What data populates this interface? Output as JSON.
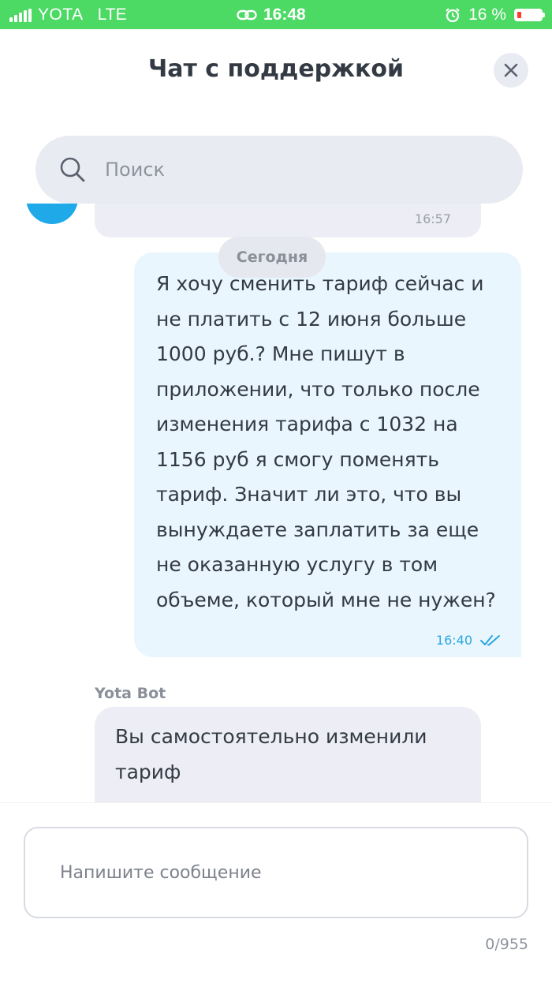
{
  "status_bar": {
    "carrier": "YOTA",
    "network": "LTE",
    "time": "16:48",
    "battery": "16 %",
    "battery_level_percent": 16,
    "bar_color": "#4cd964"
  },
  "header": {
    "title": "Чат с поддержкой",
    "close_icon": "close-icon"
  },
  "search": {
    "placeholder": "Поиск",
    "icon": "search-icon"
  },
  "chat": {
    "date_separator": "Сегодня",
    "messages": [
      {
        "direction": "outgoing",
        "text": "Я хочу сменить тариф сейчас и\nне платить с 12 июня больше\n1000 руб.? Мне пишут в\nприложении, что только после\nизменения тарифа с 1032 на\n1156 руб я смогу поменять\nтариф. Значит ли это, что вы\nвынуждаете заплатить за еще\nне оказанную услугу в том\nобъеме, который мне не нужен?",
        "time": "16:40",
        "status_icon": "double-check-icon"
      },
      {
        "direction": "incoming",
        "sender": "Yota Bot",
        "text": "Вы самостоятельно изменили тариф"
      }
    ],
    "accent_color": "#2aa6e3"
  },
  "composer": {
    "placeholder": "Напишите сообщение",
    "counter": "0/955"
  }
}
